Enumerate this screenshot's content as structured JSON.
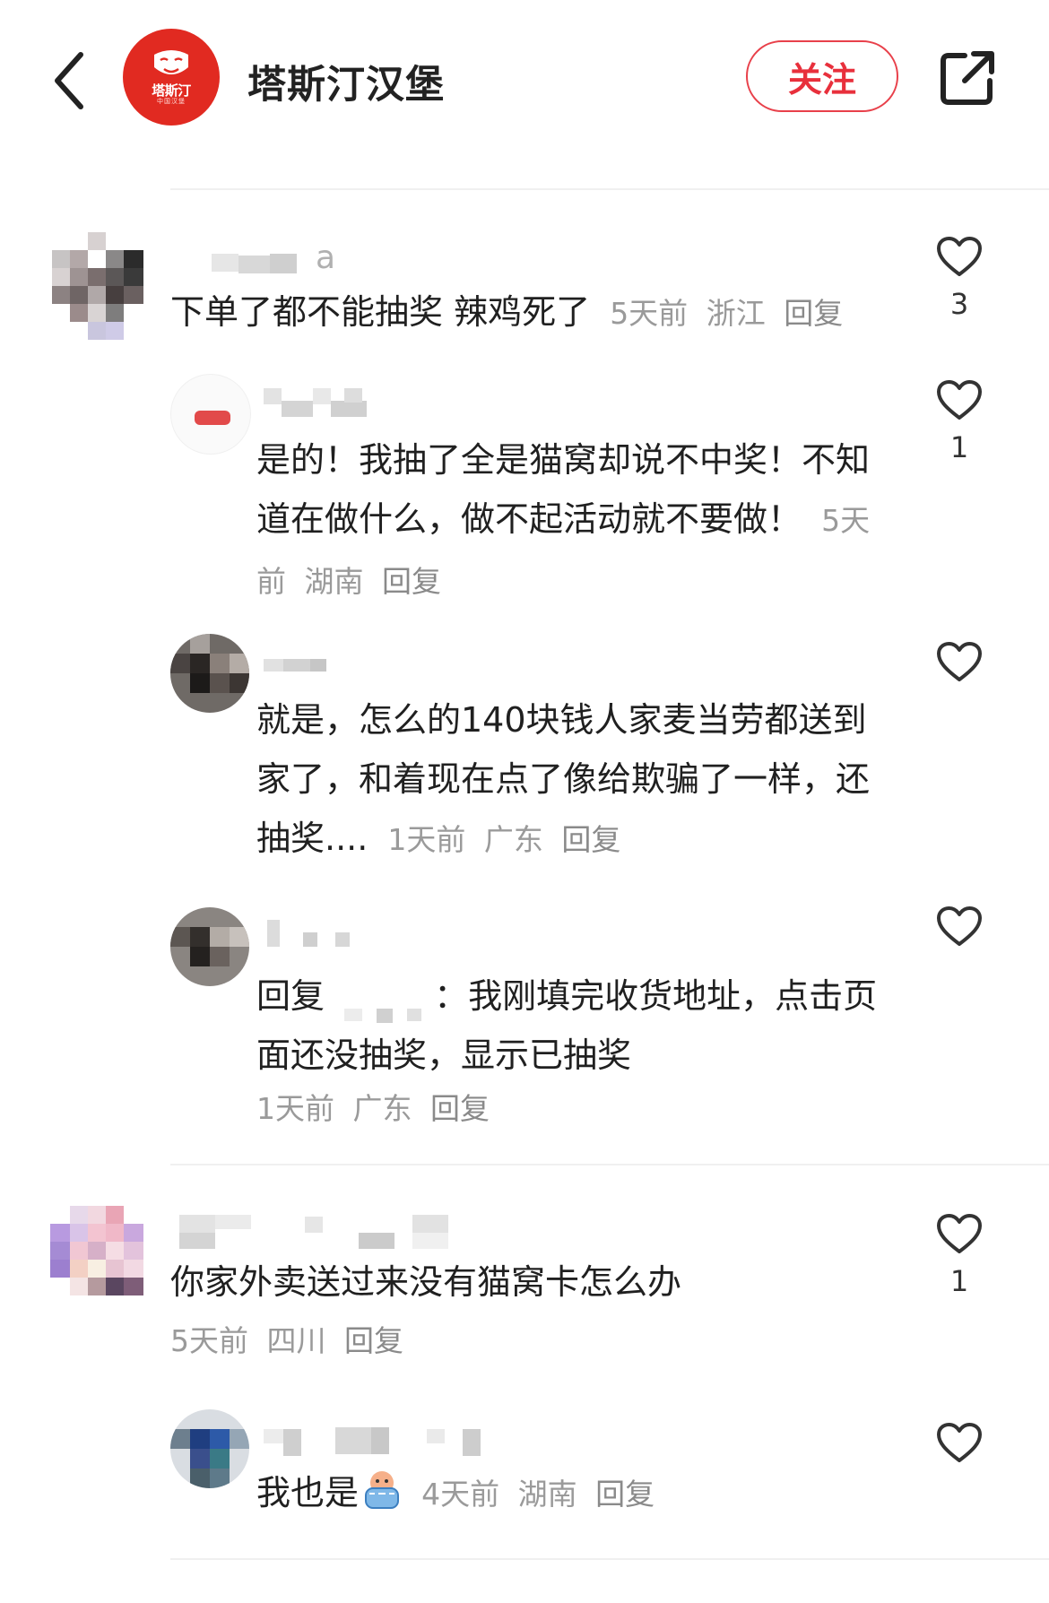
{
  "header": {
    "shop_name": "塔斯汀汉堡",
    "follow_label": "关注",
    "logo": {
      "brand_color": "#e12a21",
      "text": "塔斯汀",
      "sub": "中国汉堡"
    }
  },
  "comments": [
    {
      "username_tail": "a",
      "text": "下单了都不能抽奖 辣鸡死了",
      "time": "5天前",
      "location": "浙江",
      "reply": "回复",
      "likes": "3"
    },
    {
      "text": "是的！我抽了全是猫窝却说不中奖！不知道在做什么，做不起活动就不要做！",
      "time": "5天前",
      "location": "湖南",
      "reply": "回复",
      "likes": "1"
    },
    {
      "text": "就是，怎么的140块钱人家麦当劳都送到家了，和着现在点了像给欺骗了一样，还抽奖....",
      "time": "1天前",
      "location": "广东",
      "reply": "回复",
      "likes": ""
    },
    {
      "text_prefix": "回复",
      "text": "：我刚填完收货地址，点击页面还没抽奖，显示已抽奖",
      "time": "1天前",
      "location": "广东",
      "reply": "回复",
      "likes": ""
    },
    {
      "text": "你家外卖送过来没有猫窝卡怎么办",
      "time": "5天前",
      "location": "四川",
      "reply": "回复",
      "likes": "1"
    },
    {
      "text": "我也是",
      "emoji": "crying-emoji",
      "time": "4天前",
      "location": "湖南",
      "reply": "回复",
      "likes": ""
    }
  ],
  "colors": {
    "accent": "#e8303c",
    "meta": "#9a9a9a",
    "divider": "#f0f0f0"
  }
}
